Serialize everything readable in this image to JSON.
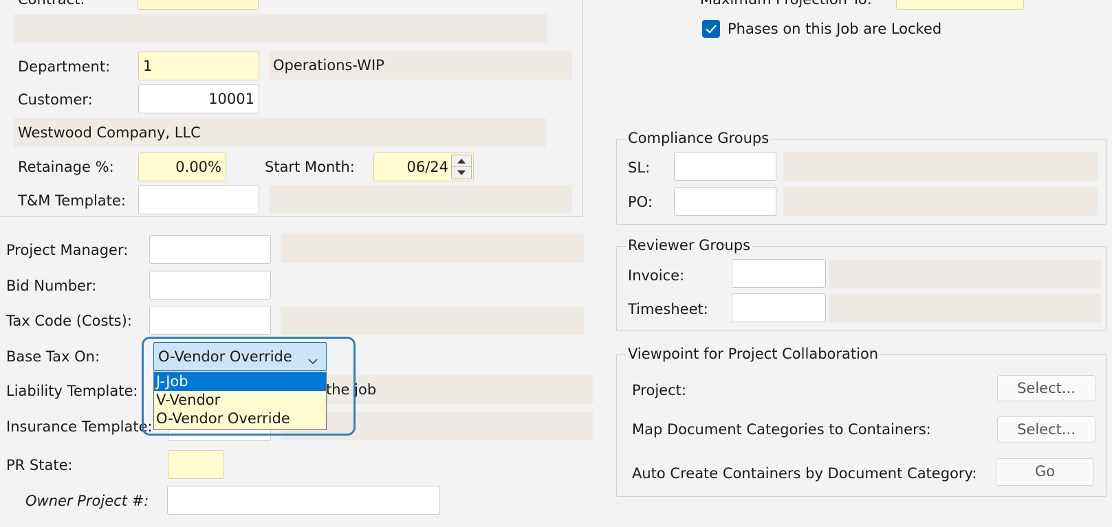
{
  "top": {
    "contract_label": "Contract:",
    "max_projection_label": "Maximum Projection To:",
    "phases_locked_label": "Phases on this Job are Locked",
    "phases_locked_checked": true
  },
  "job": {
    "department_label": "Department:",
    "department_value": "1",
    "department_desc": "Operations-WIP",
    "customer_label": "Customer:",
    "customer_value": "10001",
    "customer_name": "Westwood Company, LLC",
    "retainage_label": "Retainage %:",
    "retainage_value": "0.00%",
    "start_month_label": "Start Month:",
    "start_month_value": "06/24",
    "tm_template_label": "T&M Template:",
    "tm_template_value": ""
  },
  "details": {
    "project_manager_label": "Project Manager:",
    "project_manager_value": "",
    "bid_number_label": "Bid Number:",
    "bid_number_value": "",
    "tax_code_label": "Tax Code (Costs):",
    "tax_code_value": "",
    "base_tax_label": "Base Tax On:",
    "base_tax_value": "O-Vendor Override",
    "base_tax_options": [
      "J-Job",
      "V-Vendor",
      "O-Vendor Override"
    ],
    "base_tax_highlighted": "J-Job",
    "liability_template_label": "Liability Template:",
    "liability_desc_visible": "the job",
    "insurance_template_label": "Insurance Template:",
    "pr_state_label": "PR State:",
    "pr_state_value": "",
    "owner_project_label": "Owner Project #:",
    "owner_project_value": ""
  },
  "compliance": {
    "title": "Compliance Groups",
    "sl_label": "SL:",
    "sl_value": "",
    "po_label": "PO:",
    "po_value": ""
  },
  "reviewer": {
    "title": "Reviewer Groups",
    "invoice_label": "Invoice:",
    "invoice_value": "",
    "timesheet_label": "Timesheet:",
    "timesheet_value": ""
  },
  "collab": {
    "title": "Viewpoint for Project Collaboration",
    "project_label": "Project:",
    "project_button": "Select...",
    "map_docs_label": "Map Document Categories to Containers:",
    "map_docs_button": "Select...",
    "auto_create_label": "Auto Create Containers by Document Category:",
    "auto_create_button": "Go"
  },
  "colors": {
    "required_field": "#fffbd0",
    "description_field": "#efebe4",
    "accent": "#0078d4",
    "focus_ring": "#2f7fc6"
  }
}
